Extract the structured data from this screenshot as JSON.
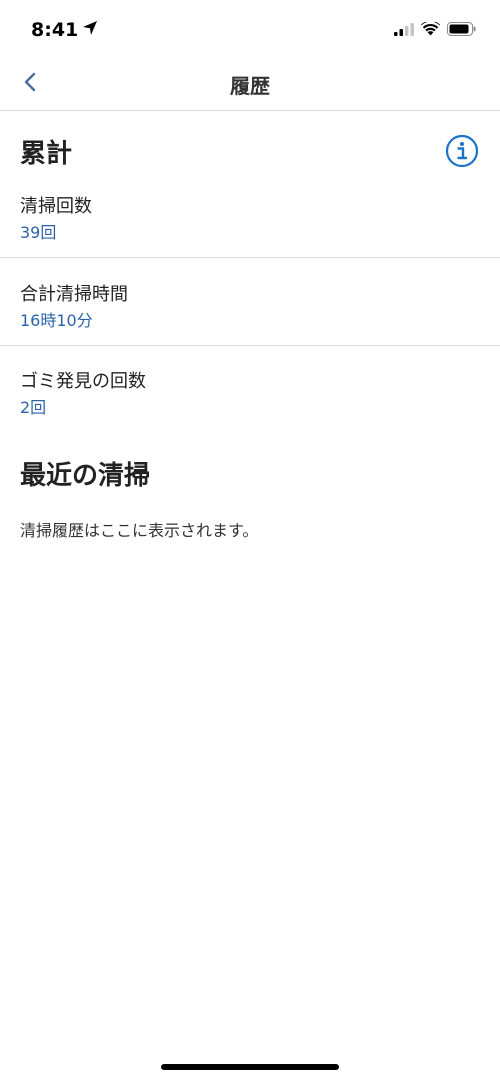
{
  "status_bar": {
    "time": "8:41",
    "location_icon": "location-arrow-icon",
    "signal_icon": "cellular-signal-icon",
    "wifi_icon": "wifi-icon",
    "battery_icon": "battery-icon"
  },
  "nav": {
    "back_icon": "chevron-left-icon",
    "title": "履歴"
  },
  "totals": {
    "title": "累計",
    "info_icon": "info-icon",
    "items": [
      {
        "label": "清掃回数",
        "value": "39回"
      },
      {
        "label": "合計清掃時間",
        "value": "16時10分"
      },
      {
        "label": "ゴミ発見の回数",
        "value": "2回"
      }
    ]
  },
  "recent": {
    "title": "最近の清掃",
    "empty_message": "清掃履歴はここに表示されます。"
  },
  "colors": {
    "accent": "#1a73c8",
    "value_text": "#2e63a8",
    "divider": "#d8d8d8",
    "background": "#ffffff"
  }
}
